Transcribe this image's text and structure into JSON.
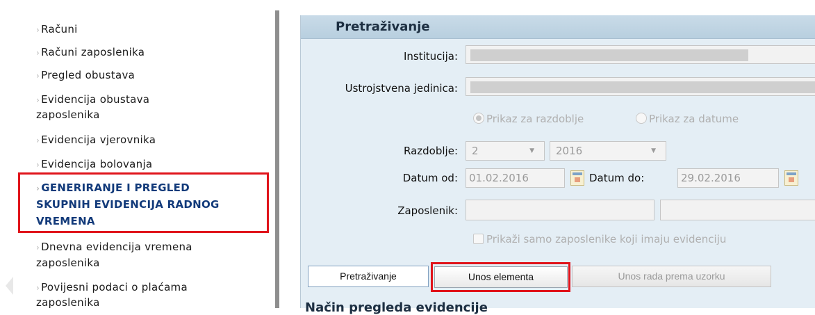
{
  "sidebar": {
    "items": [
      {
        "label": "Računi"
      },
      {
        "label": "Računi zaposlenika"
      },
      {
        "label": "Pregled obustava"
      },
      {
        "label": "Evidencija obustava",
        "label2": "zaposlenika"
      },
      {
        "label": "Evidencija vjerovnika"
      },
      {
        "label": "Evidencija bolovanja"
      },
      {
        "label": "GENERIRANJE I PREGLED",
        "label2": "SKUPNIH EVIDENCIJA RADNOG",
        "label3": "VREMENA"
      },
      {
        "label": "Dnevna evidencija vremena",
        "label2": "zaposlenika"
      },
      {
        "label": "Povijesni podaci o plaćama",
        "label2": "zaposlenika"
      }
    ],
    "bullet": "›"
  },
  "panel": {
    "title": "Pretraživanje",
    "institucija_label": "Institucija:",
    "ustrojstvena_label": "Ustrojstvena jedinica:",
    "radio_razdoblje": "Prikaz za razdoblje",
    "radio_datume": "Prikaz za datume",
    "razdoblje_label": "Razdoblje:",
    "razdoblje_month": "2",
    "razdoblje_year": "2016",
    "datum_od_label": "Datum od:",
    "datum_od_value": "01.02.2016",
    "datum_do_label": "Datum do:",
    "datum_do_value": "29.02.2016",
    "zaposlenik_label": "Zaposlenik:",
    "checkbox_label": "Prikaži samo zaposlenike koji imaju evidenciju",
    "subheading": "Način pregleda evidencije"
  },
  "buttons": {
    "search": "Pretraživanje",
    "unos_elementa": "Unos elementa",
    "unos_rada": "Unos rada prema uzorku"
  }
}
